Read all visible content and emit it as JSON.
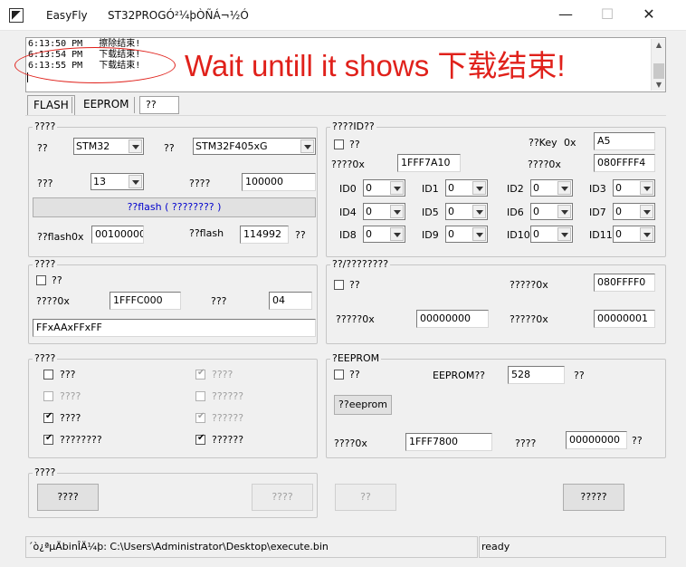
{
  "window": {
    "app_name": "EasyFly",
    "subtitle": "ST32PROGÓ²¼þÒÑÁ¬½Ó",
    "minimize": "—",
    "maximize": "☐",
    "close": "✕"
  },
  "log": {
    "lines": [
      "6:13:50 PM   擦除结束!",
      "6:13:54 PM   下载结束!",
      "6:13:55 PM   下载结束!"
    ]
  },
  "annotation": {
    "text": "Wait untill it shows 下载结束!",
    "color": "#e0211b"
  },
  "tabs": {
    "flash": "FLASH",
    "eeprom": "EEPROM",
    "third": "??"
  },
  "group_chip": {
    "title": "????",
    "lbl_a": "??",
    "combo_a": "STM32",
    "lbl_b": "??",
    "combo_b": "STM32F405xG",
    "lbl_c": "???",
    "combo_c": "13",
    "lbl_d": "????",
    "value_d": "100000",
    "read_flash_button": "??flash ( ???????? )",
    "lbl_flash_addr": "??flash0x",
    "flash_addr": "00100000",
    "lbl_flash_size": "??flash",
    "flash_size": "114992",
    "lbl_flash_unit": "??"
  },
  "group_id": {
    "title": "????ID??",
    "chk_label": "??",
    "lbl_key": "??Key",
    "lbl_key_0x": "0x",
    "key": "A5",
    "lbl_addr1": "????0x",
    "addr1": "1FFF7A10",
    "lbl_addr2": "????0x",
    "addr2": "080FFFF4",
    "ids": [
      {
        "label": "ID0",
        "value": "0"
      },
      {
        "label": "ID1",
        "value": "0"
      },
      {
        "label": "ID2",
        "value": "0"
      },
      {
        "label": "ID3",
        "value": "0"
      },
      {
        "label": "ID4",
        "value": "0"
      },
      {
        "label": "ID5",
        "value": "0"
      },
      {
        "label": "ID6",
        "value": "0"
      },
      {
        "label": "ID7",
        "value": "0"
      },
      {
        "label": "ID8",
        "value": "0"
      },
      {
        "label": "ID9",
        "value": "0"
      },
      {
        "label": "ID10",
        "value": "0"
      },
      {
        "label": "ID11",
        "value": "0"
      }
    ]
  },
  "group_option": {
    "title": "????",
    "chk_label": "??",
    "lbl_addr": "????0x",
    "addr": "1FFFC000",
    "lbl_len": "???",
    "len": "04",
    "bytes": "FFxAAxFFxFF"
  },
  "group_serial": {
    "title": "??/????????",
    "chk_label": "??",
    "lbl_addr": "?????0x",
    "addr": "080FFFF0",
    "lbl_start": "?????0x",
    "start": "00000000",
    "lbl_step": "?????0x",
    "step": "00000001"
  },
  "group_ops": {
    "title": "????",
    "items": [
      {
        "label": "???",
        "checked": false,
        "enabled": true
      },
      {
        "label": "????",
        "checked": true,
        "enabled": false
      },
      {
        "label": "????",
        "checked": false,
        "enabled": false
      },
      {
        "label": "??????",
        "checked": false,
        "enabled": false
      },
      {
        "label": "????",
        "checked": true,
        "enabled": true
      },
      {
        "label": "??????",
        "checked": true,
        "enabled": false
      },
      {
        "label": "????????",
        "checked": true,
        "enabled": true
      },
      {
        "label": "??????",
        "checked": true,
        "enabled": true
      }
    ]
  },
  "group_eeprom": {
    "title": "?EEPROM",
    "chk_label": "??",
    "lbl_size": "EEPROM??",
    "size": "528",
    "lbl_unit": "??",
    "button": "??eeprom",
    "lbl_addr": "????0x",
    "addr": "1FFF7800",
    "lbl_val": "????",
    "val": "00000000",
    "lbl_val_unit": "??"
  },
  "group_action": {
    "title": "????",
    "btn1": "????",
    "btn2": "????"
  },
  "bottom_buttons": {
    "btn_mid": "??",
    "btn_right": "?????"
  },
  "statusbar": {
    "file": "´ò¿ªµÄbinÎÄ¼þ:  C:\\Users\\Administrator\\Desktop\\execute.bin",
    "state": "ready"
  }
}
